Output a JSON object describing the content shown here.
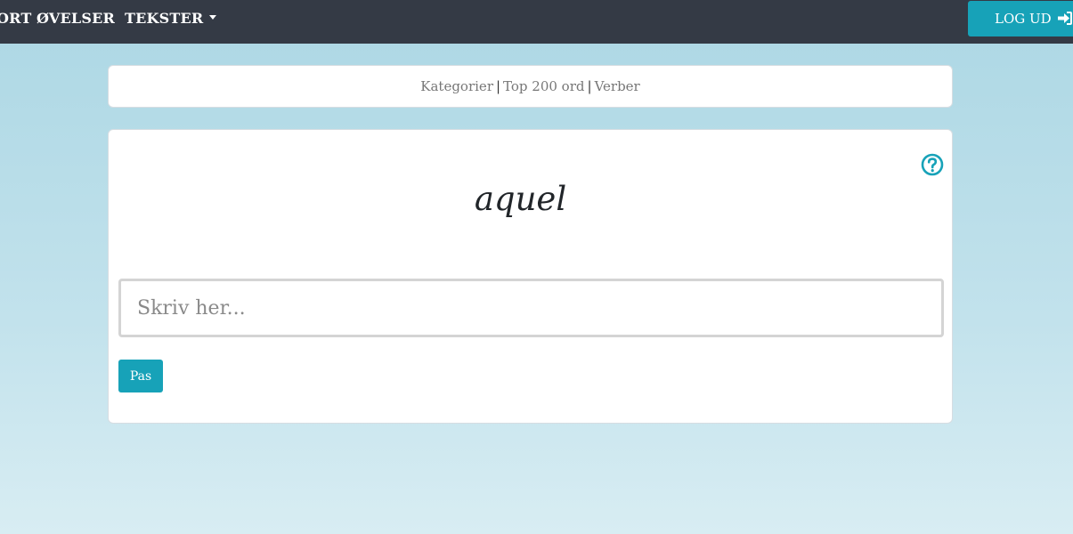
{
  "nav": {
    "items": [
      {
        "label": "ORT"
      },
      {
        "label": "ØVELSER"
      },
      {
        "label": "TEKSTER"
      }
    ],
    "logout_label": "LOG UD"
  },
  "subnav": {
    "links": [
      "Kategorier",
      "Top 200 ord",
      "Verber"
    ],
    "separator": "|"
  },
  "exercise": {
    "word": "aquel",
    "input_placeholder": "Skriv her...",
    "input_value": "",
    "pass_label": "Pas"
  },
  "colors": {
    "navbar": "#343a45",
    "accent": "#17a2b8",
    "background_top": "#acd7e4",
    "background_bottom": "#d8edf3"
  },
  "icons": {
    "logout": "sign-in-icon",
    "help": "question-circle-icon",
    "dropdown": "caret-down-icon"
  }
}
